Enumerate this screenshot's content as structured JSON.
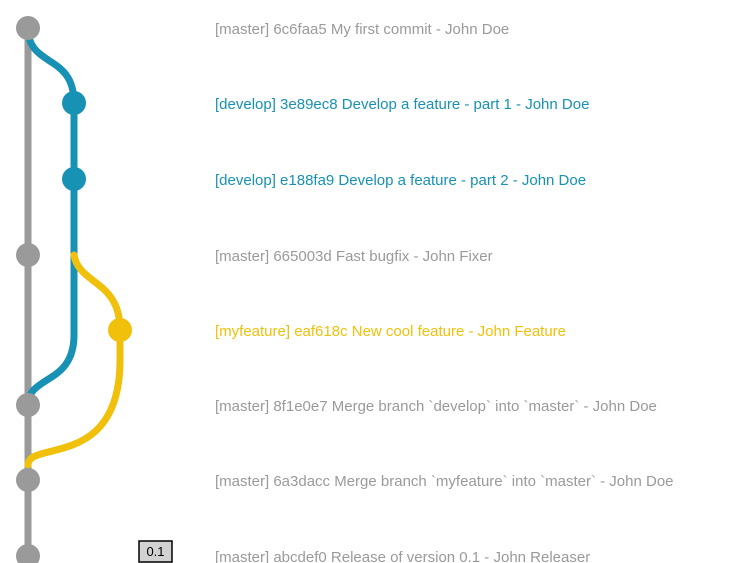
{
  "colors": {
    "master": "#9a9a9a",
    "develop": "#1791b4",
    "myfeature": "#f0c00a",
    "tag_fill": "#d2d2d2",
    "tag_border": "#000000",
    "tag_text": "#000000"
  },
  "branches": [
    "master",
    "develop",
    "myfeature"
  ],
  "commits": [
    {
      "branch": "master",
      "text": "[master] 6c6faa5 My first commit - John Doe"
    },
    {
      "branch": "develop",
      "text": "[develop] 3e89ec8 Develop a feature - part 1 - John Doe"
    },
    {
      "branch": "develop",
      "text": "[develop] e188fa9 Develop a feature - part 2 - John Doe"
    },
    {
      "branch": "master",
      "text": "[master] 665003d Fast bugfix - John Fixer"
    },
    {
      "branch": "myfeature",
      "text": "[myfeature] eaf618c New cool feature - John Feature"
    },
    {
      "branch": "master",
      "text": "[master] 8f1e0e7 Merge branch `develop` into `master` - John Doe"
    },
    {
      "branch": "master",
      "text": "[master] 6a3dacc Merge branch `myfeature` into `master` - John Doe"
    },
    {
      "branch": "master",
      "text": "[master] abcdef0 Release of version 0.1 - John Releaser",
      "tag": "0.1"
    }
  ]
}
